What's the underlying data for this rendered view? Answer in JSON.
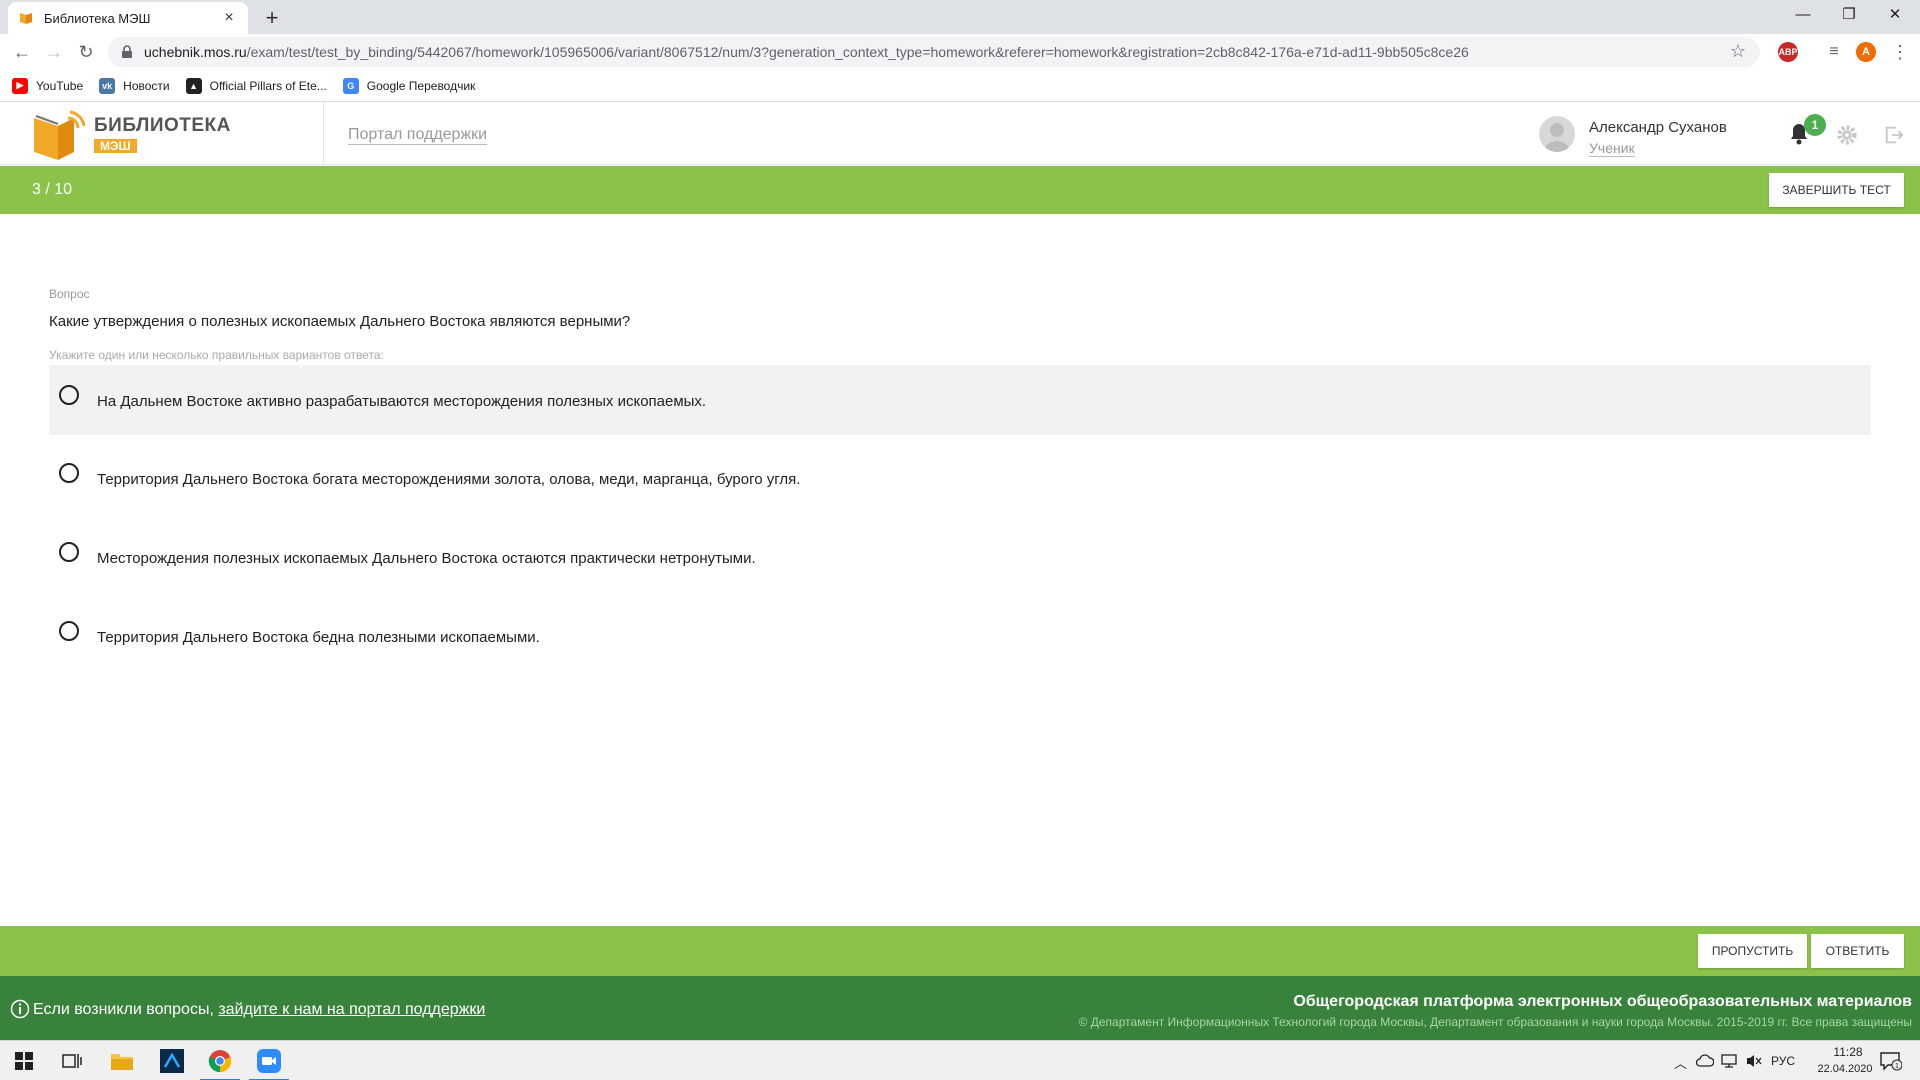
{
  "browser": {
    "tab_title": "Библиотека МЭШ",
    "new_tab": "+",
    "close_tab": "×",
    "url_host": "uchebnik.mos.ru",
    "url_path": "/exam/test/test_by_binding/5442067/homework/105965006/variant/8067512/num/3?generation_context_type=homework&referer=homework&registration=2cb8c842-176a-e71d-ad11-9bb505c8ce26",
    "ext_abp": "ABP",
    "profile_initial": "A",
    "bookmarks": [
      {
        "label": "YouTube",
        "icon": "youtube-icon",
        "color": "#ff0000"
      },
      {
        "label": "Новости",
        "icon": "vk-icon",
        "color": "#4a76a8"
      },
      {
        "label": "Official Pillars of Ete...",
        "icon": "pillars-icon",
        "color": "#222222"
      },
      {
        "label": "Google Переводчик",
        "icon": "google-translate-icon",
        "color": "#4285f4"
      }
    ]
  },
  "header": {
    "logo_title": "БИБЛИОТЕКА",
    "logo_sub": "МЭШ",
    "support_link": "Портал поддержки",
    "user_name": "Александр Суханов",
    "user_role": "Ученик",
    "notification_count": "1"
  },
  "test": {
    "counter": "3 / 10",
    "finish_label": "ЗАВЕРШИТЬ ТЕСТ",
    "question_caption": "Вопрос",
    "question_text": "Какие утверждения о полезных ископаемых Дальнего Востока являются верными?",
    "hint": "Укажите один или несколько правильных вариантов ответа:",
    "answers": [
      "На Дальнем Востоке активно разрабатываются месторождения полезных ископаемых.",
      "Территория Дальнего Востока богата месторождениями золота, олова, меди, марганца, бурого угля.",
      "Месторождения полезных ископаемых Дальнего Востока остаются практически нетронутыми.",
      "Территория Дальнего Востока бедна полезными ископаемыми."
    ],
    "skip_label": "ПРОПУСТИТЬ",
    "answer_label": "ОТВЕТИТЬ"
  },
  "footer": {
    "question_prefix": "Если возникли вопросы, ",
    "question_link": "зайдите к нам на портал поддержки",
    "title": "Общегородская платформа электронных общеобразовательных материалов",
    "copyright": "© Департамент Информационных Технологий города Москвы, Департамент образования и науки города Москвы. 2015-2019 гг. Все права защищены"
  },
  "taskbar": {
    "lang": "РУС",
    "time": "11:28",
    "date": "22.04.2020",
    "notif_count": "1"
  },
  "colors": {
    "accent_green": "#8bc34a",
    "footer_green": "#39823b",
    "logo_orange": "#f2a92b"
  }
}
